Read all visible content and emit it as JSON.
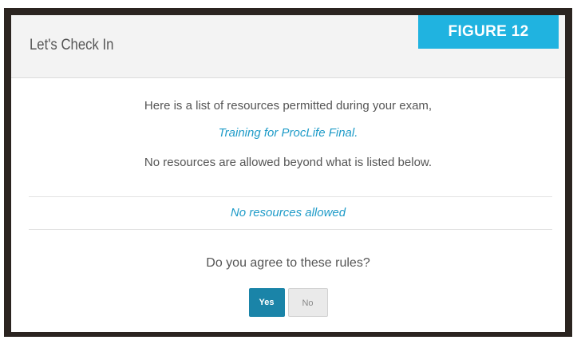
{
  "dialog": {
    "title": "Let's Check In",
    "badge": "FIGURE 12"
  },
  "content": {
    "intro": "Here is a list of resources permitted during your exam,",
    "exam_name": "Training for ProcLife Final.",
    "notice": "No resources are allowed beyond what is listed below.",
    "resources": "No resources allowed",
    "question": "Do you agree to these rules?"
  },
  "buttons": {
    "yes_label": "Yes",
    "no_label": "No"
  },
  "colors": {
    "accent": "#20b3e0",
    "primary_button": "#1a84a8",
    "link_text": "#1e9bc8"
  }
}
